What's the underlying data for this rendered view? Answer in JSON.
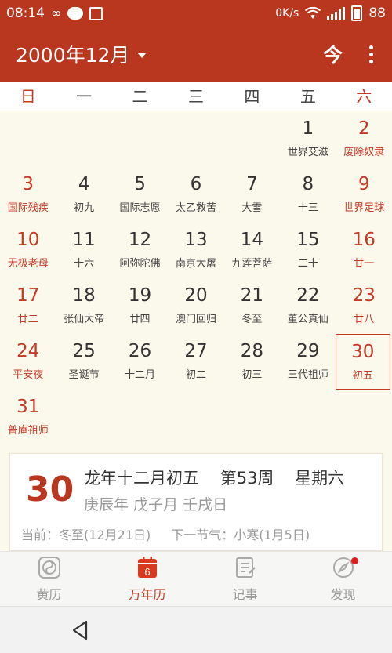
{
  "status_bar": {
    "time": "08:14",
    "speed": "0K/s",
    "battery": "88"
  },
  "app_bar": {
    "title": "2000年12月",
    "today_label": "今"
  },
  "weekdays": [
    "日",
    "一",
    "二",
    "三",
    "四",
    "五",
    "六"
  ],
  "calendar": {
    "leading_blanks": 5,
    "selected_day": 30,
    "days": [
      {
        "day": "1",
        "sub": "世界艾滋",
        "red": false
      },
      {
        "day": "2",
        "sub": "废除奴隶",
        "red": true
      },
      {
        "day": "3",
        "sub": "国际残疾",
        "red": true
      },
      {
        "day": "4",
        "sub": "初九",
        "red": false
      },
      {
        "day": "5",
        "sub": "国际志愿",
        "red": false
      },
      {
        "day": "6",
        "sub": "太乙救苦",
        "red": false
      },
      {
        "day": "7",
        "sub": "大雪",
        "red": false
      },
      {
        "day": "8",
        "sub": "十三",
        "red": false
      },
      {
        "day": "9",
        "sub": "世界足球",
        "red": true
      },
      {
        "day": "10",
        "sub": "无极老母",
        "red": true
      },
      {
        "day": "11",
        "sub": "十六",
        "red": false
      },
      {
        "day": "12",
        "sub": "阿弥陀佛",
        "red": false
      },
      {
        "day": "13",
        "sub": "南京大屠",
        "red": false
      },
      {
        "day": "14",
        "sub": "九莲菩萨",
        "red": false
      },
      {
        "day": "15",
        "sub": "二十",
        "red": false
      },
      {
        "day": "16",
        "sub": "廿一",
        "red": true
      },
      {
        "day": "17",
        "sub": "廿二",
        "red": true
      },
      {
        "day": "18",
        "sub": "张仙大帝",
        "red": false
      },
      {
        "day": "19",
        "sub": "廿四",
        "red": false
      },
      {
        "day": "20",
        "sub": "澳门回归",
        "red": false
      },
      {
        "day": "21",
        "sub": "冬至",
        "red": false
      },
      {
        "day": "22",
        "sub": "董公真仙",
        "red": false
      },
      {
        "day": "23",
        "sub": "廿八",
        "red": true
      },
      {
        "day": "24",
        "sub": "平安夜",
        "red": true
      },
      {
        "day": "25",
        "sub": "圣诞节",
        "red": false
      },
      {
        "day": "26",
        "sub": "十二月",
        "red": false
      },
      {
        "day": "27",
        "sub": "初二",
        "red": false
      },
      {
        "day": "28",
        "sub": "初三",
        "red": false
      },
      {
        "day": "29",
        "sub": "三代祖师",
        "red": false
      },
      {
        "day": "30",
        "sub": "初五",
        "red": true
      },
      {
        "day": "31",
        "sub": "普庵祖师",
        "red": true
      }
    ]
  },
  "detail": {
    "day": "30",
    "lunar_date": "龙年十二月初五",
    "week_no": "第53周",
    "weekday": "星期六",
    "ganzhi": "庚辰年 戊子月 壬戌日",
    "current_term": "当前：冬至(12月21日)",
    "next_term": "下一节气：小寒(1月5日)"
  },
  "tabs": [
    {
      "label": "黄历",
      "icon": "yinyang-icon",
      "active": false
    },
    {
      "label": "万年历",
      "icon": "calendar-icon",
      "active": true,
      "icon_text": "6"
    },
    {
      "label": "记事",
      "icon": "note-icon",
      "active": false
    },
    {
      "label": "发现",
      "icon": "compass-icon",
      "active": false,
      "badge": true
    }
  ],
  "colors": {
    "primary": "#b9361f",
    "red_text": "#c53a24",
    "background": "#fbf8ec"
  }
}
